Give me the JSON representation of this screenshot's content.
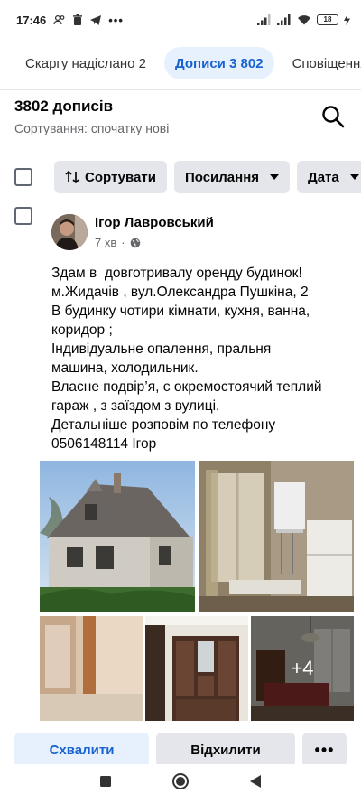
{
  "status_bar": {
    "time": "17:46",
    "battery": "18"
  },
  "tabs": [
    {
      "label": "Скаргу надіслано 2",
      "active": false
    },
    {
      "label": "Дописи 3 802",
      "active": true
    },
    {
      "label": "Сповіщення",
      "active": false
    }
  ],
  "list_header": {
    "count": "3802 дописів",
    "sort_label": "Сортування: спочатку нові"
  },
  "filters": {
    "sort": "Сортувати",
    "links": "Посилання",
    "date": "Дата"
  },
  "post": {
    "author": "Ігор Лавровський",
    "time": "7 хв",
    "text_lines": [
      "Здам в  довготривалу оренду будинок!",
      "м.Жидачів , вул.Олександра Пушкіна, 2",
      "В будинку чотири кімнати, кухня, ванна,",
      "коридор ;",
      "Індивідуальне опалення, пральня",
      "машина, холодильник.",
      "Власне подвір’я, є окремостоячий теплий",
      "гараж , з заїздом з вулиці.",
      "Детальніше розповім по телефону",
      "0506148114 Ігор"
    ],
    "more_photos": "+4"
  },
  "actions": {
    "approve": "Схвалити",
    "decline": "Відхилити",
    "more": "•••"
  },
  "colors": {
    "accent": "#1763cf",
    "accent_bg": "#e7f0fd",
    "button_bg": "#e4e6eb",
    "secondary_text": "#65676b"
  }
}
